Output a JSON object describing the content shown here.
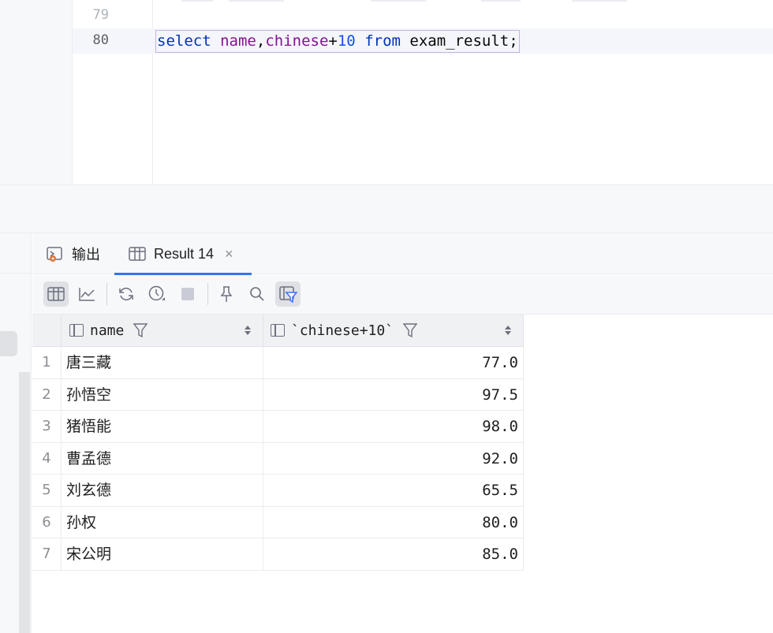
{
  "editor": {
    "line_numbers": [
      "79",
      "80"
    ],
    "code": {
      "kw_select": "select",
      "col_name": "name",
      "comma": ",",
      "col_chinese": "chinese",
      "plus": "+",
      "number": "10",
      "kw_from": "from",
      "table": "exam_result",
      "semicolon": ";"
    }
  },
  "tabs": {
    "output_label": "输出",
    "result_label": "Result 14",
    "close_glyph": "×"
  },
  "toolbar": {
    "icons": [
      "table-view-icon",
      "chart-view-icon",
      "refresh-icon",
      "history-icon",
      "stop-icon",
      "pin-icon",
      "search-icon",
      "filter-toggle-icon"
    ]
  },
  "grid": {
    "columns": [
      "name",
      "`chinese+10`"
    ],
    "rows": [
      {
        "num": "1",
        "name": "唐三藏",
        "value": "77.0"
      },
      {
        "num": "2",
        "name": "孙悟空",
        "value": "97.5"
      },
      {
        "num": "3",
        "name": "猪悟能",
        "value": "98.0"
      },
      {
        "num": "4",
        "name": "曹孟德",
        "value": "92.0"
      },
      {
        "num": "5",
        "name": "刘玄德",
        "value": "65.5"
      },
      {
        "num": "6",
        "name": "孙权",
        "value": "80.0"
      },
      {
        "num": "7",
        "name": "宋公明",
        "value": "85.0"
      }
    ]
  },
  "colors": {
    "keyword": "#0033b3",
    "column": "#871094",
    "number": "#1750eb",
    "accent": "#3574f0"
  }
}
